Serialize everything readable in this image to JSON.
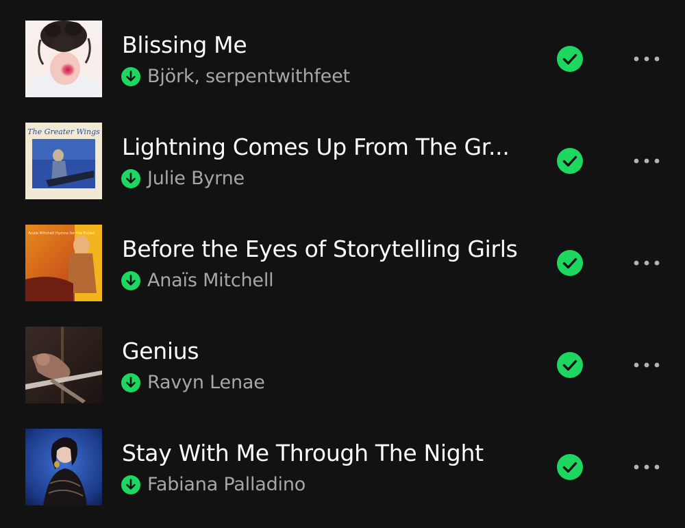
{
  "tracks": [
    {
      "title": "Blissing Me",
      "artist": "Björk, serpentwithfeet",
      "downloaded": true,
      "liked": true,
      "art_text": ""
    },
    {
      "title": "Lightning Comes Up From The Gr...",
      "artist": "Julie Byrne",
      "downloaded": true,
      "liked": true,
      "art_text": "The Greater Wings"
    },
    {
      "title": "Before the Eyes of Storytelling Girls",
      "artist": "Anaïs Mitchell",
      "downloaded": true,
      "liked": true,
      "art_text": "Anaïs Mitchell Hymns for the Exiled"
    },
    {
      "title": "Genius",
      "artist": "Ravyn Lenae",
      "downloaded": true,
      "liked": true,
      "art_text": ""
    },
    {
      "title": "Stay With Me Through The Night",
      "artist": "Fabiana Palladino",
      "downloaded": true,
      "liked": true,
      "art_text": ""
    }
  ],
  "icons": {
    "download": "download-arrow-icon",
    "liked": "check-circle-icon",
    "more": "more-options-icon"
  },
  "colors": {
    "background": "#121212",
    "title": "#ffffff",
    "subtitle": "#a7a7a7",
    "accent": "#1ed760"
  }
}
